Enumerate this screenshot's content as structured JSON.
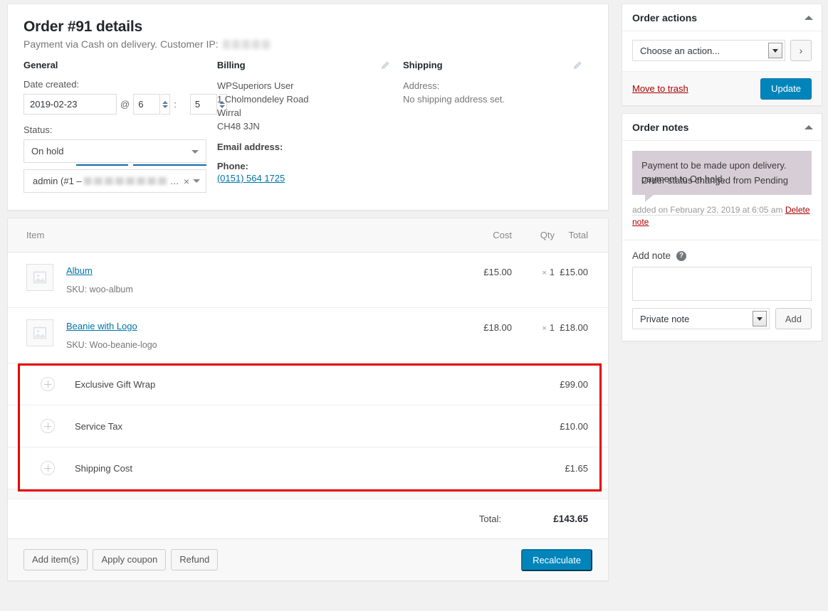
{
  "order": {
    "title": "Order #91 details",
    "subtitle_prefix": "Payment via Cash on delivery. Customer IP:"
  },
  "general": {
    "heading": "General",
    "date_label": "Date created:",
    "date_value": "2019-02-23",
    "at_symbol": "@",
    "hour_value": "6",
    "time_separator": ":",
    "minute_value": "5",
    "status_label": "Status:",
    "status_value": "On hold",
    "customer_value": "admin (#1 –",
    "customer_ellipsis": "…",
    "customer_clear": "×"
  },
  "billing": {
    "heading": "Billing",
    "name": "WPSuperiors User",
    "address1": "1 Cholmondeley Road",
    "city": "Wirral",
    "postcode": "CH48 3JN",
    "email_label": "Email address:",
    "phone_label": "Phone:",
    "phone_value": "(0151) 564 1725"
  },
  "shipping": {
    "heading": "Shipping",
    "address_label": "Address:",
    "address_value": "No shipping address set."
  },
  "items": {
    "columns": {
      "item": "Item",
      "cost": "Cost",
      "qty": "Qty",
      "total": "Total"
    },
    "rows": [
      {
        "name": "Album",
        "sku": "SKU: woo-album",
        "cost": "£15.00",
        "qty_mark": "×",
        "qty": "1",
        "total": "£15.00"
      },
      {
        "name": "Beanie with Logo",
        "sku": "SKU: Woo-beanie-logo",
        "cost": "£18.00",
        "qty_mark": "×",
        "qty": "1",
        "total": "£18.00"
      }
    ],
    "fees": [
      {
        "name": "Exclusive Gift Wrap",
        "amount": "£99.00"
      },
      {
        "name": "Service Tax",
        "amount": "£10.00"
      },
      {
        "name": "Shipping Cost",
        "amount": "£1.65"
      }
    ],
    "total_label": "Total:",
    "total_value": "£143.65",
    "buttons": {
      "add_items": "Add item(s)",
      "apply_coupon": "Apply coupon",
      "refund": "Refund",
      "recalculate": "Recalculate"
    }
  },
  "order_actions": {
    "title": "Order actions",
    "action_select_value": "Choose an action...",
    "go_label": "›",
    "trash_label": "Move to trash",
    "update_label": "Update"
  },
  "order_notes": {
    "title": "Order notes",
    "note_line_1": "Payment to be made upon delivery.",
    "note_line_2": "payment to On hold.",
    "note_line_3": "Order status changed from Pending",
    "note_time": "added on February 23, 2019 at 6:05 am",
    "delete_label": "Delete note",
    "add_note_label": "Add note",
    "help_glyph": "?",
    "note_textarea_value": "",
    "note_type_value": "Private note",
    "add_button": "Add"
  },
  "colors": {
    "accent_blue": "#0085ba",
    "link_blue": "#0073aa",
    "highlight_red": "#e60000",
    "note_bubble": "#d7cdd6",
    "trash_red": "#a00"
  }
}
